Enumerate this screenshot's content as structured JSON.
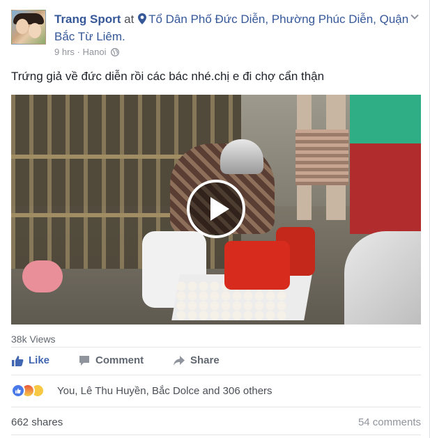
{
  "post": {
    "author": "Trang Sport",
    "at_word": "at",
    "location": "Tổ Dân Phố Đức Diễn, Phường Phúc Diễn, Quận Bắc Từ Liêm.",
    "time": "9 hrs",
    "dot": "·",
    "place_meta": "Hanoi",
    "text": "Trứng giả về đức diễn rồi các bác nhé.chị e đi chợ cẩn thận"
  },
  "video": {
    "views": "38k Views"
  },
  "actions": {
    "like": "Like",
    "comment": "Comment",
    "share": "Share"
  },
  "reactions": {
    "summary": "You, Lê Thu Huyền, Bắc Dolce and 306 others",
    "types": [
      "like-icon",
      "angry-icon",
      "haha-icon"
    ]
  },
  "stats": {
    "shares": "662 shares",
    "comments": "54 comments"
  },
  "colors": {
    "link": "#365899",
    "like_blue": "#4267b2",
    "muted": "#90949c"
  }
}
